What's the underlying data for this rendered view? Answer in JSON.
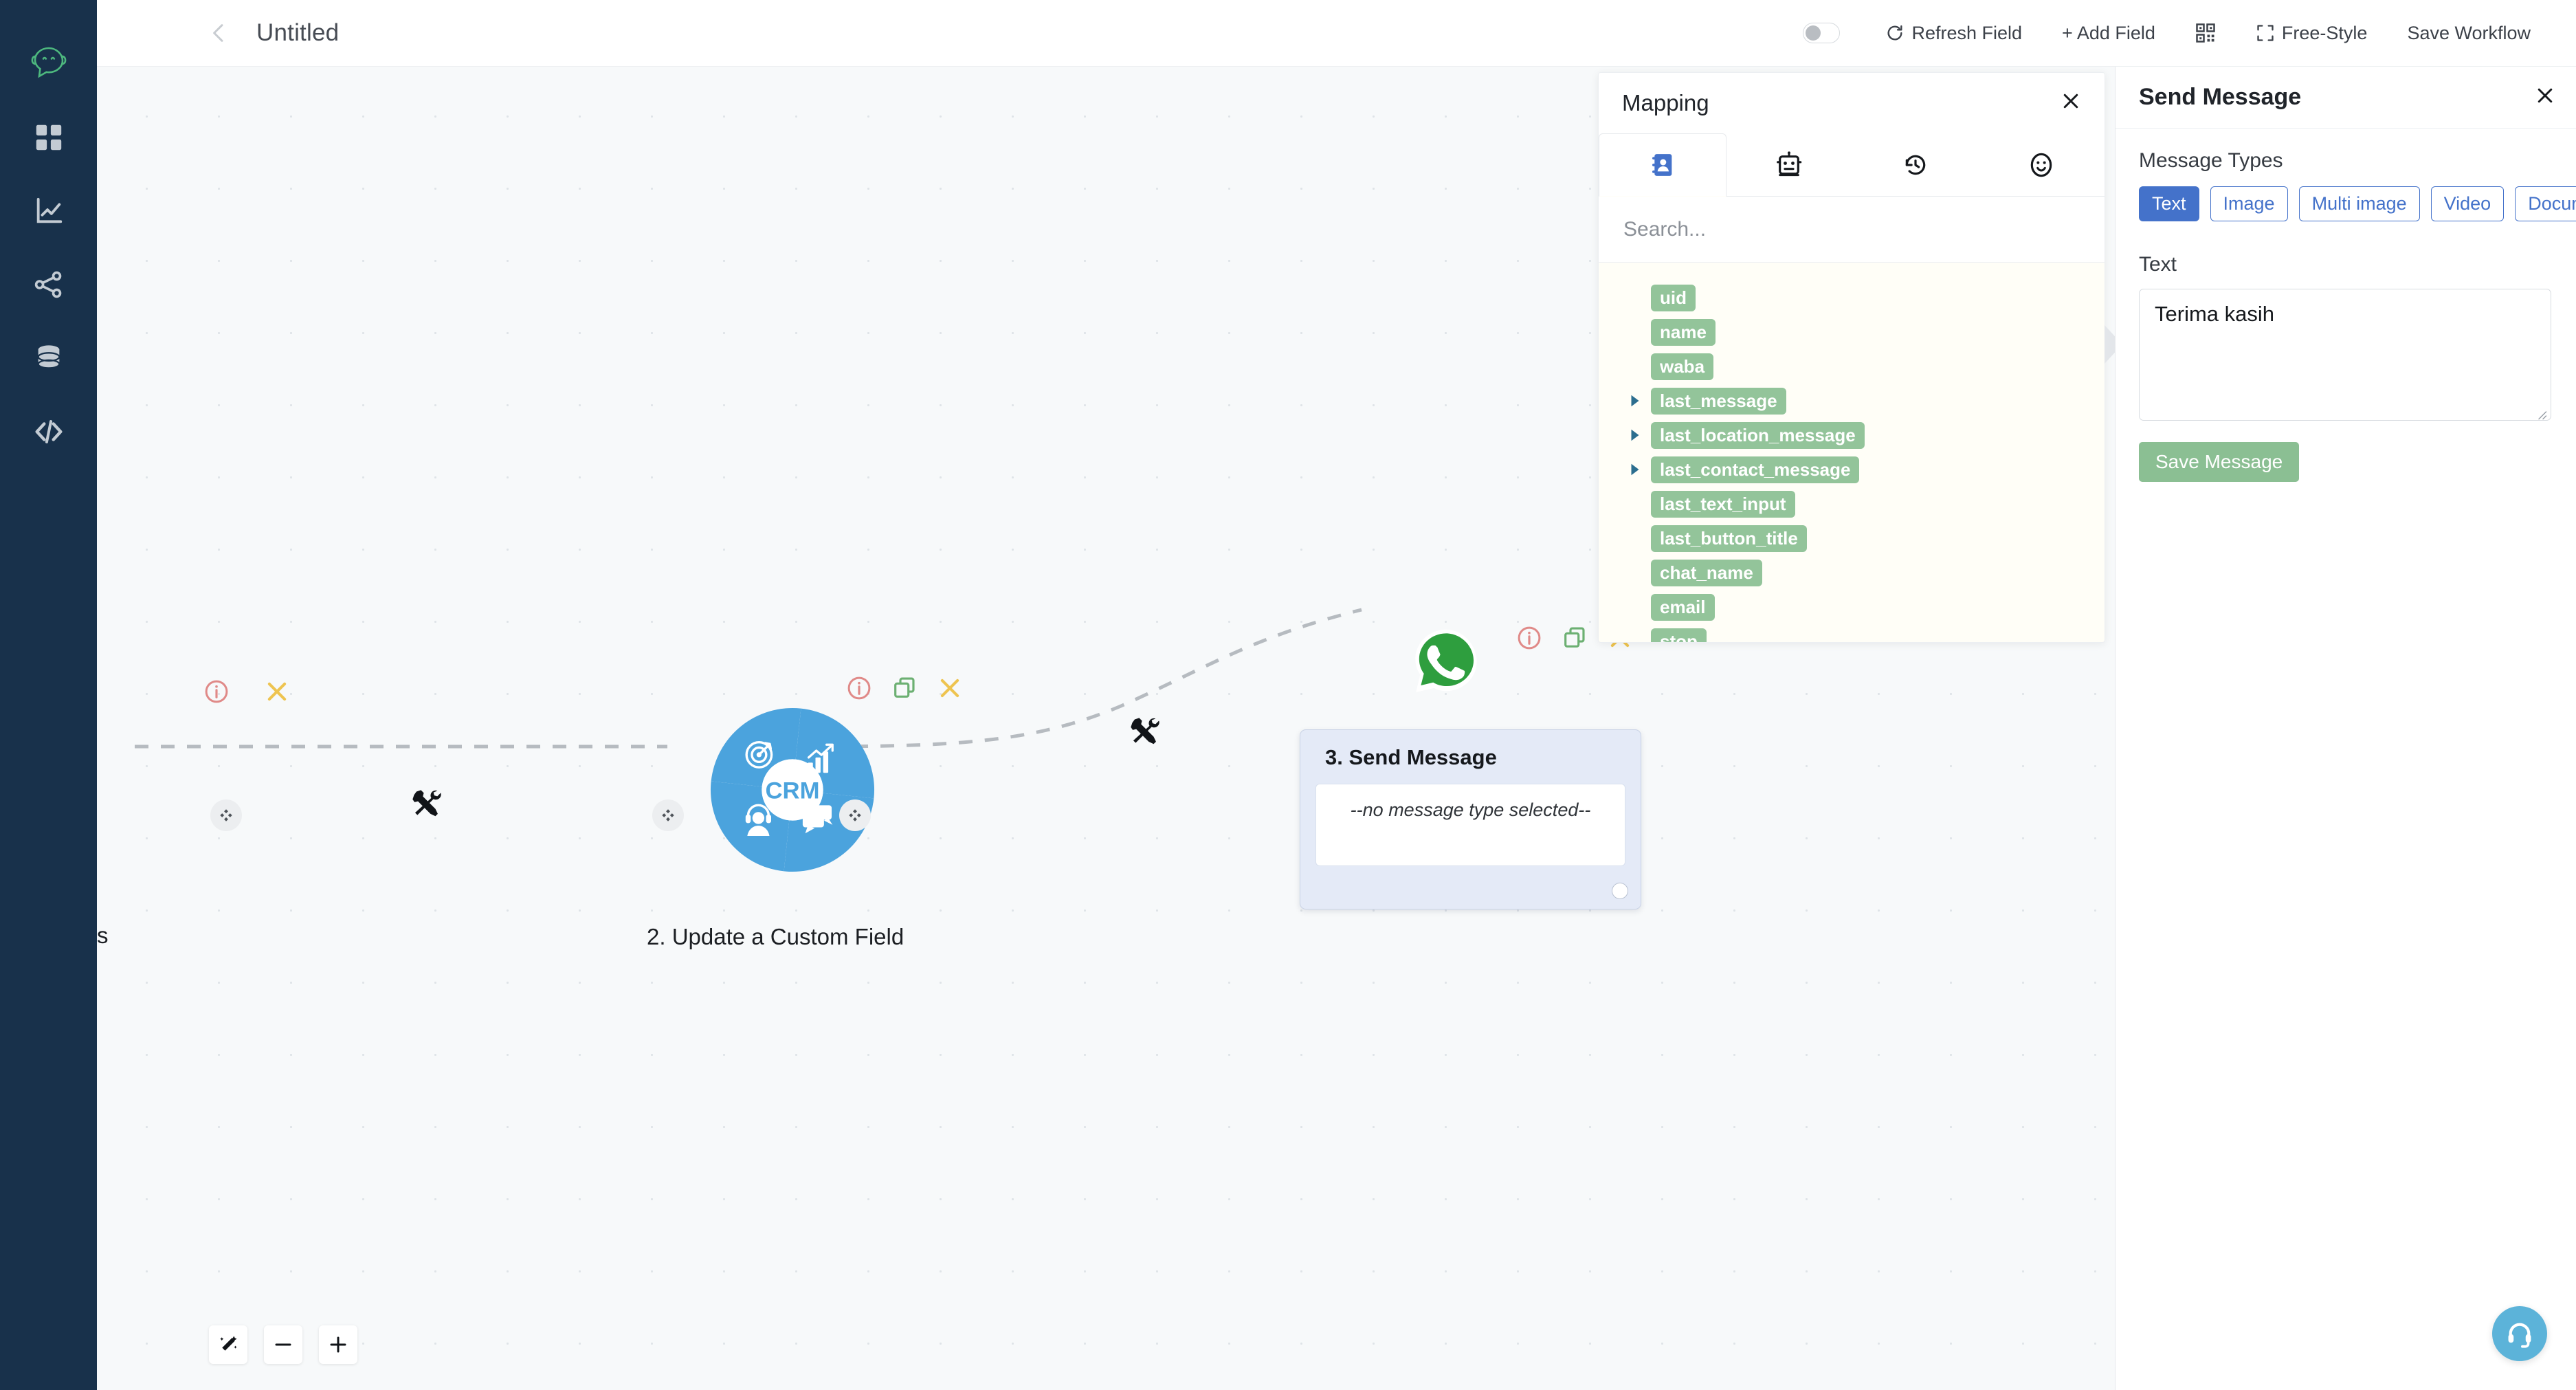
{
  "sidebar": {
    "logo_icon": "chat-smiley-logo",
    "items": [
      {
        "icon": "grid-dashboard-icon",
        "name": "dashboard"
      },
      {
        "icon": "analytics-chart-icon",
        "name": "analytics"
      },
      {
        "icon": "share-network-icon",
        "name": "flows"
      },
      {
        "icon": "database-icon",
        "name": "database"
      },
      {
        "icon": "code-brackets-icon",
        "name": "developer"
      }
    ]
  },
  "header": {
    "back_icon": "chevron-left-icon",
    "title": "Untitled",
    "toggle_on": false,
    "buttons": [
      {
        "label": "Refresh Field",
        "icon": "refresh-icon"
      },
      {
        "label": "+ Add Field",
        "icon": "plus-icon"
      },
      {
        "label": "",
        "icon": "qr-code-icon"
      },
      {
        "label": "Free-Style",
        "icon": "crop-frame-icon"
      },
      {
        "label": "Save Workflow",
        "icon": ""
      }
    ]
  },
  "canvas": {
    "clipped_node_label": "s",
    "nodes": [
      {
        "id": "crm",
        "label": "2. Update a Custom Field",
        "icon": "crm-wheel-icon",
        "center_text": "CRM",
        "actions": [
          "info-icon",
          "duplicate-icon",
          "delete-icon"
        ]
      },
      {
        "id": "send-message",
        "icon": "whatsapp-icon",
        "card_title": "3. Send Message",
        "card_body": "--no message type selected--",
        "actions": [
          "info-icon",
          "duplicate-icon",
          "delete-icon"
        ]
      }
    ],
    "edge_tool_icon": "tools-wrench-screwdriver-icon",
    "zoom_controls": [
      {
        "icon": "magic-wand-icon",
        "name": "auto-layout"
      },
      {
        "icon": "minus-icon",
        "name": "zoom-out"
      },
      {
        "icon": "plus-icon",
        "name": "zoom-in"
      }
    ],
    "support_fab_icon": "headset-support-icon"
  },
  "mapping": {
    "title": "Mapping",
    "close_icon": "close-icon",
    "tabs": [
      {
        "icon": "contact-book-icon",
        "name": "contact",
        "active": true
      },
      {
        "icon": "robot-icon",
        "name": "bot",
        "active": false
      },
      {
        "icon": "history-clock-icon",
        "name": "history",
        "active": false
      },
      {
        "icon": "smiley-face-icon",
        "name": "emoji",
        "active": false
      }
    ],
    "search": {
      "value": "",
      "placeholder": "Search..."
    },
    "fields": [
      {
        "label": "uid",
        "expandable": false
      },
      {
        "label": "name",
        "expandable": false
      },
      {
        "label": "waba",
        "expandable": false
      },
      {
        "label": "last_message",
        "expandable": true
      },
      {
        "label": "last_location_message",
        "expandable": true
      },
      {
        "label": "last_contact_message",
        "expandable": true
      },
      {
        "label": "last_text_input",
        "expandable": false
      },
      {
        "label": "last_button_title",
        "expandable": false
      },
      {
        "label": "chat_name",
        "expandable": false
      },
      {
        "label": "email",
        "expandable": false
      },
      {
        "label": "stop",
        "expandable": false
      },
      {
        "label": "",
        "expandable": false
      }
    ],
    "chip_color": "#93c49a"
  },
  "right_panel": {
    "title": "Send Message",
    "close_icon": "close-icon",
    "message_types_label": "Message Types",
    "message_types": [
      {
        "label": "Text",
        "active": true
      },
      {
        "label": "Image",
        "active": false
      },
      {
        "label": "Multi image",
        "active": false
      },
      {
        "label": "Video",
        "active": false
      },
      {
        "label": "Document",
        "active": false
      }
    ],
    "text_label": "Text",
    "text_value": "Terima kasih",
    "save_label": "Save Message",
    "accent_color": "#4472ca",
    "save_color": "#8bbf93"
  }
}
